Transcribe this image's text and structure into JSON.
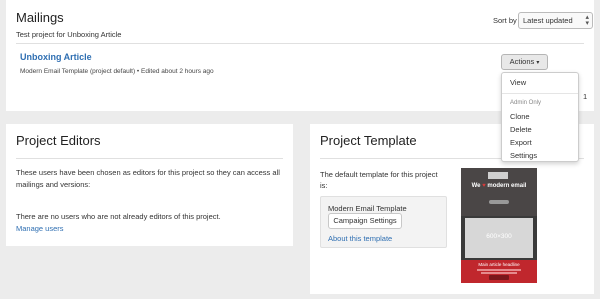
{
  "mailings": {
    "title": "Mailings",
    "subtitle": "Test project for Unboxing Article",
    "sort_label": "Sort by",
    "sort_value": "Latest updated",
    "item": {
      "title": "Unboxing Article",
      "meta": "Modern Email Template (project default) • Edited about 2 hours ago",
      "actions_label": "Actions"
    },
    "page_number": "1"
  },
  "actions_menu": {
    "view": "View",
    "admin_header": "Admin Only",
    "clone": "Clone",
    "delete": "Delete",
    "export": "Export",
    "settings": "Settings"
  },
  "editors": {
    "title": "Project Editors",
    "description": "These users have been chosen as editors for this project so they can access all mailings and versions:",
    "no_users": "There are no users who are not already editors of this project.",
    "manage_link": "Manage users"
  },
  "template": {
    "title": "Project Template",
    "description": "The default template for this project is:",
    "name": "Modern Email Template",
    "campaign_button": "Campaign Settings",
    "about_link": "About this template",
    "thumbnail": {
      "headline_before": "We",
      "headline_after": "modern email",
      "placeholder_text": "600×300",
      "footer_text": "Main article headline"
    }
  },
  "colors": {
    "link": "#2f6fb2",
    "accent_red": "#c0272d"
  }
}
